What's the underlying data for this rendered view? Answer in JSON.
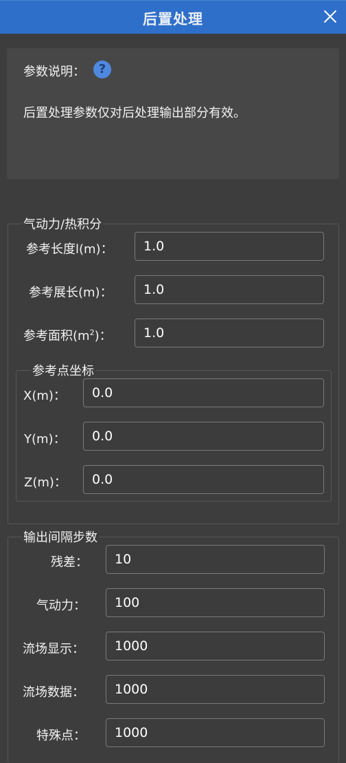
{
  "window": {
    "title": "后置处理",
    "close_icon": "close-icon"
  },
  "description": {
    "label": "参数说明：",
    "help_icon": "?",
    "text": "后置处理参数仅对后处理输出部分有效。"
  },
  "aero_thermal_group": {
    "title": "气动力/热积分",
    "ref_length": {
      "label": "参考长度l(m)：",
      "value": "1.0"
    },
    "ref_span": {
      "label": "参考展长(m)：",
      "value": "1.0"
    },
    "ref_area": {
      "label_pre": "参考面积(m",
      "label_sup": "2",
      "label_post": ")：",
      "value": "1.0"
    },
    "ref_point": {
      "title": "参考点坐标",
      "x": {
        "label": "X(m)：",
        "value": "0.0"
      },
      "y": {
        "label": "Y(m)：",
        "value": "0.0"
      },
      "z": {
        "label": "Z(m)：",
        "value": "0.0"
      }
    }
  },
  "output_interval_group": {
    "title": "输出间隔步数",
    "residual": {
      "label": "残差：",
      "value": "10"
    },
    "aero_force": {
      "label": "气动力：",
      "value": "100"
    },
    "flow_display": {
      "label": "流场显示：",
      "value": "1000"
    },
    "flow_data": {
      "label": "流场数据：",
      "value": "1000"
    },
    "special_point": {
      "label": "特殊点：",
      "value": "1000"
    }
  }
}
